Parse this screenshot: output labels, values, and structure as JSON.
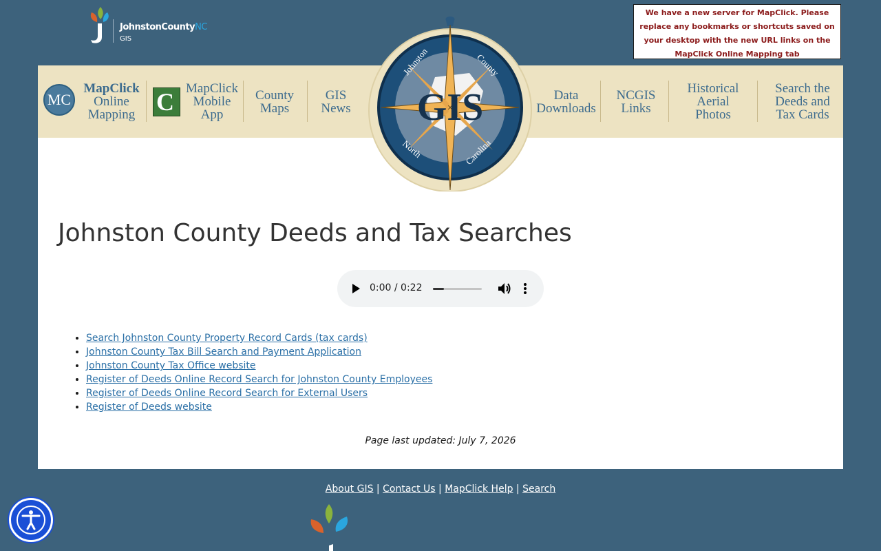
{
  "logo": {
    "brand_main": "JohnstonCounty",
    "brand_suffix": "NC",
    "sub": "GIS"
  },
  "notice": {
    "text": "We have a new server for MapClick. Please replace any bookmarks or shortcuts saved on your desktop with the new URL links on the MapClick Online Mapping tab"
  },
  "nav": {
    "mapclick": [
      "MapClick",
      "Online",
      "Mapping"
    ],
    "mobile": [
      "MapClick",
      "Mobile",
      "App"
    ],
    "county_maps": [
      "County",
      "Maps"
    ],
    "gis_news": [
      "GIS",
      "News"
    ],
    "data_downloads": [
      "Data",
      "Downloads"
    ],
    "ncgis": [
      "NCGIS",
      "Links"
    ],
    "historical": [
      "Historical",
      "Aerial",
      "Photos"
    ],
    "search_deeds": [
      "Search the",
      "Deeds and",
      "Tax Cards"
    ]
  },
  "compass": {
    "center": "GIS",
    "top_left": "Johnston",
    "top_right": "County",
    "bottom_left": "North",
    "bottom_right": "Carolina"
  },
  "page": {
    "title": "Johnston County Deeds and Tax Searches"
  },
  "audio": {
    "time": "0:00 / 0:22",
    "progress": 0.22
  },
  "links": [
    "Search Johnston County Property Record Cards (tax cards)",
    "Johnston County Tax Bill Search and Payment Application",
    "Johnston County Tax Office website",
    "Register of Deeds Online Record Search for Johnston County Employees",
    "Register of Deeds Online Record Search for External Users",
    "Register of Deeds website"
  ],
  "updated": "Page last updated:  July 7, 2026",
  "footer": {
    "about": "About GIS",
    "contact": "Contact Us",
    "help": "MapClick Help",
    "search": "Search",
    "sep": " | "
  },
  "colors": {
    "background": "#3d627c",
    "navbar": "#ede3c2",
    "link": "#2a6fa6",
    "notice_text": "#8b1a1a",
    "a11y": "#1a4fd6"
  }
}
